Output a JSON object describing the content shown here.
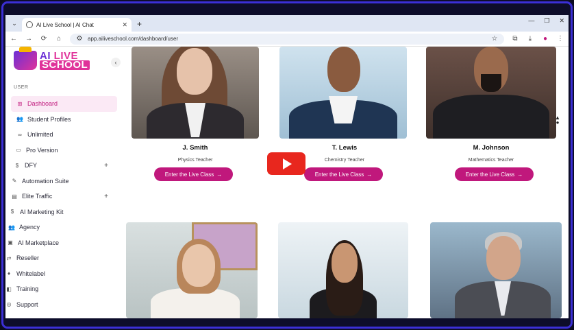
{
  "browser": {
    "tab_title": "AI Live School | AI Chat",
    "url": "app.ailiveschool.com/dashboard/user",
    "tab_close": "✕",
    "new_tab": "+",
    "controls": {
      "minimize": "—",
      "restore": "❐",
      "close": "✕"
    },
    "icons": {
      "back": "←",
      "forward": "→",
      "reload": "⟳",
      "home": "⌂",
      "star": "☆",
      "extensions": "⧉",
      "download": "⤓",
      "menu": "⋮",
      "tab_list": "⌄",
      "site_info": "⚙"
    }
  },
  "logo": {
    "line1_a": "AI ",
    "line1_b": "LIVE",
    "line2": "SCHOOL"
  },
  "sidebar": {
    "collapse": "‹",
    "section": "USER",
    "items": [
      {
        "label": "Dashboard",
        "icon": "⊞",
        "active": true
      },
      {
        "label": "Student Profiles",
        "icon": "👥"
      },
      {
        "label": "Unlimited",
        "icon": "∞"
      },
      {
        "label": "Pro Version",
        "icon": "▭"
      },
      {
        "label": "DFY",
        "icon": "$",
        "plus": "+"
      },
      {
        "label": "Automation Suite",
        "icon": "✎"
      },
      {
        "label": "Elite Traffic",
        "icon": "▤",
        "plus": "+"
      },
      {
        "label": "AI Marketing Kit",
        "icon": "$"
      },
      {
        "label": "Agency",
        "icon": "👥"
      },
      {
        "label": "AI Marketplace",
        "icon": "▣"
      },
      {
        "label": "Reseller",
        "icon": "⇄"
      },
      {
        "label": "Whitelabel",
        "icon": "♦"
      },
      {
        "label": "Training",
        "icon": "◧"
      },
      {
        "label": "Support",
        "icon": "◎"
      }
    ]
  },
  "teachers": [
    {
      "name": "J. Smith",
      "role": "Physics Teacher",
      "button": "Enter the Live Class",
      "arrow": "→"
    },
    {
      "name": "T. Lewis",
      "role": "Chemistry Teacher",
      "button": "Enter the Live Class",
      "arrow": "→"
    },
    {
      "name": "M. Johnson",
      "role": "Mathematics Teacher",
      "button": "Enter the Live Class",
      "arrow": "→"
    }
  ],
  "overlay": {
    "scroll_up": "▲",
    "scroll_dot": "●"
  },
  "colors": {
    "accent": "#c0187c",
    "brand_purple": "#6b2fd6",
    "frame": "#3b2fd6",
    "youtube": "#e8271e"
  }
}
